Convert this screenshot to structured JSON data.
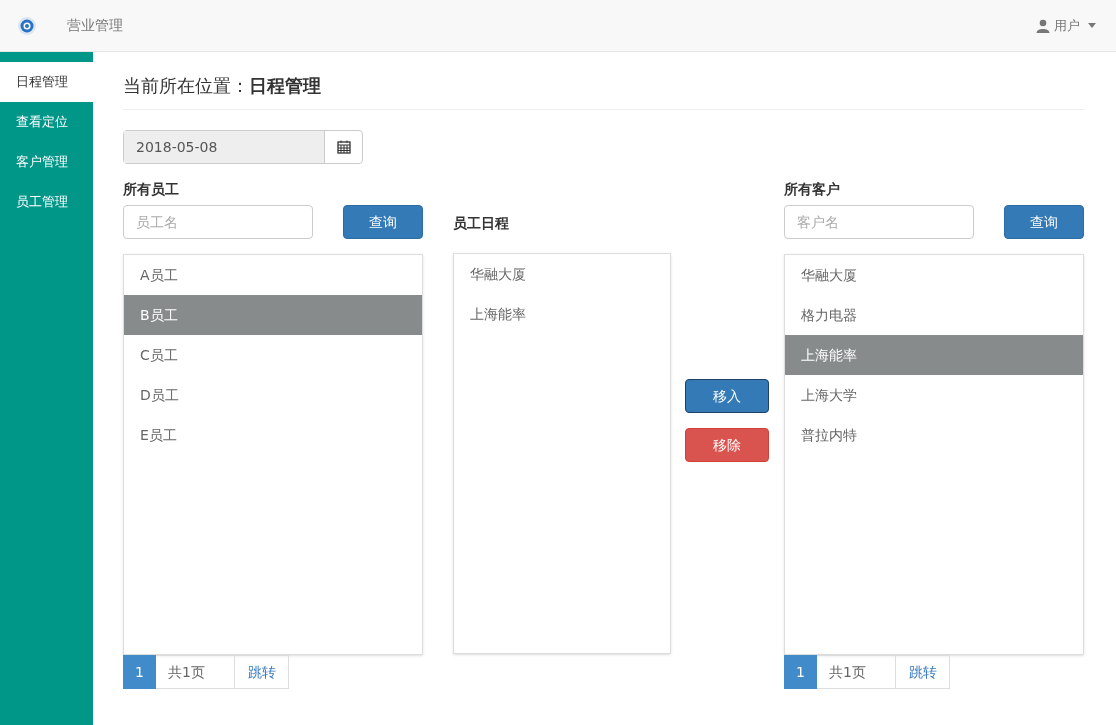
{
  "header": {
    "app_title": "营业管理",
    "user": "用户"
  },
  "sidebar": {
    "items": [
      {
        "label": "日程管理",
        "selected": true
      },
      {
        "label": "查看定位",
        "selected": false
      },
      {
        "label": "客户管理",
        "selected": false
      },
      {
        "label": "员工管理",
        "selected": false
      }
    ]
  },
  "breadcrumb": {
    "prefix": "当前所在位置：",
    "current": "日程管理"
  },
  "date_field": {
    "value": "2018-05-08"
  },
  "employees": {
    "title": "所有员工",
    "search": {
      "placeholder": "员工名"
    },
    "search_button": "查询",
    "items": [
      {
        "label": "A员工",
        "selected": false
      },
      {
        "label": "B员工",
        "selected": true
      },
      {
        "label": "C员工",
        "selected": false
      },
      {
        "label": "D员工",
        "selected": false
      },
      {
        "label": "E员工",
        "selected": false
      }
    ],
    "pagination": {
      "page": "1",
      "total": "共1页",
      "jump": "跳转"
    }
  },
  "schedule": {
    "title": "员工日程",
    "items": [
      {
        "label": "华融大厦",
        "selected": false
      },
      {
        "label": "上海能率",
        "selected": false
      }
    ]
  },
  "actions": {
    "move_in": "移入",
    "remove": "移除"
  },
  "customers": {
    "title": "所有客户",
    "search": {
      "placeholder": "客户名"
    },
    "search_button": "查询",
    "items": [
      {
        "label": "华融大厦",
        "selected": false
      },
      {
        "label": "格力电器",
        "selected": false
      },
      {
        "label": "上海能率",
        "selected": true
      },
      {
        "label": "上海大学",
        "selected": false
      },
      {
        "label": "普拉内特",
        "selected": false
      }
    ],
    "pagination": {
      "page": "1",
      "total": "共1页",
      "jump": "跳转"
    }
  }
}
